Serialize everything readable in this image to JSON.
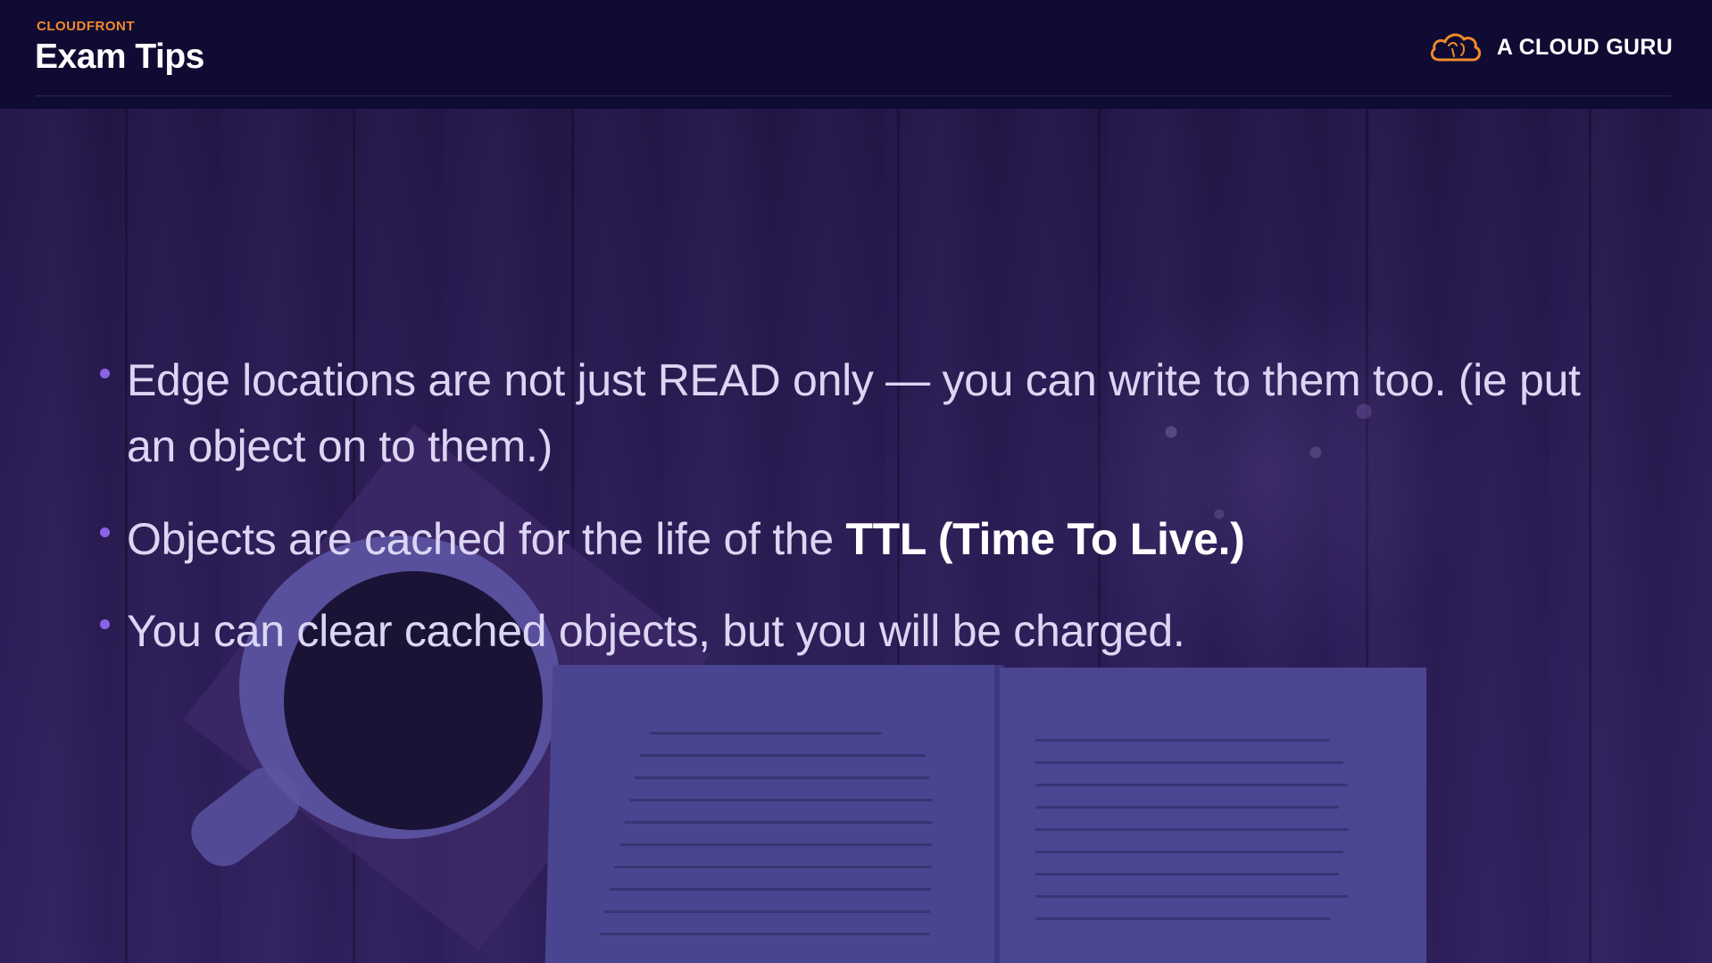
{
  "header": {
    "section_label": "CLOUDFRONT",
    "title": "Exam Tips",
    "brand_name": "A CLOUD GURU",
    "brand_icon": "cloud-logo-icon"
  },
  "colors": {
    "header_bg": "#0f0b33",
    "accent_orange": "#f28a2a",
    "bullet_purple": "#8a63e6",
    "body_text": "#dcd6f4"
  },
  "bullets": [
    {
      "text": "Edge locations are not just READ only — you can write to them too. (ie put an object on to them.)"
    },
    {
      "text_prefix": "Objects are cached for the life of the ",
      "emphasis": "TTL (Time To Live.)"
    },
    {
      "text": "You can clear cached objects, but you will be charged."
    }
  ]
}
